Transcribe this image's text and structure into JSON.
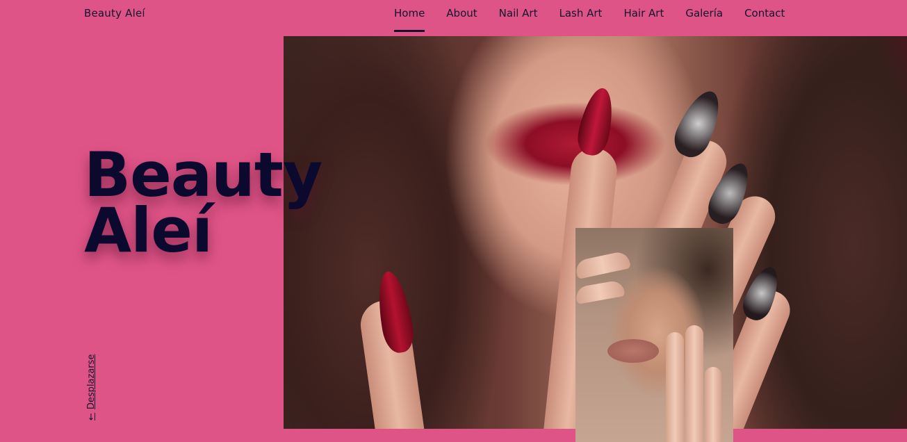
{
  "header": {
    "brand": "Beauty Aleí",
    "nav": [
      {
        "label": "Home",
        "active": true
      },
      {
        "label": "About",
        "active": false
      },
      {
        "label": "Nail Art",
        "active": false
      },
      {
        "label": "Lash Art",
        "active": false
      },
      {
        "label": "Hair Art",
        "active": false
      },
      {
        "label": "Galería",
        "active": false
      },
      {
        "label": "Contact",
        "active": false
      }
    ]
  },
  "hero": {
    "title_line1": "Beauty",
    "title_line2": "Aleí",
    "scroll_label": "Desplazarse",
    "scroll_icon": "arrow-down-icon"
  },
  "colors": {
    "background": "#df5487",
    "text": "#14112e",
    "title": "#0b0a2e",
    "nail_red": "#8d0e26"
  }
}
